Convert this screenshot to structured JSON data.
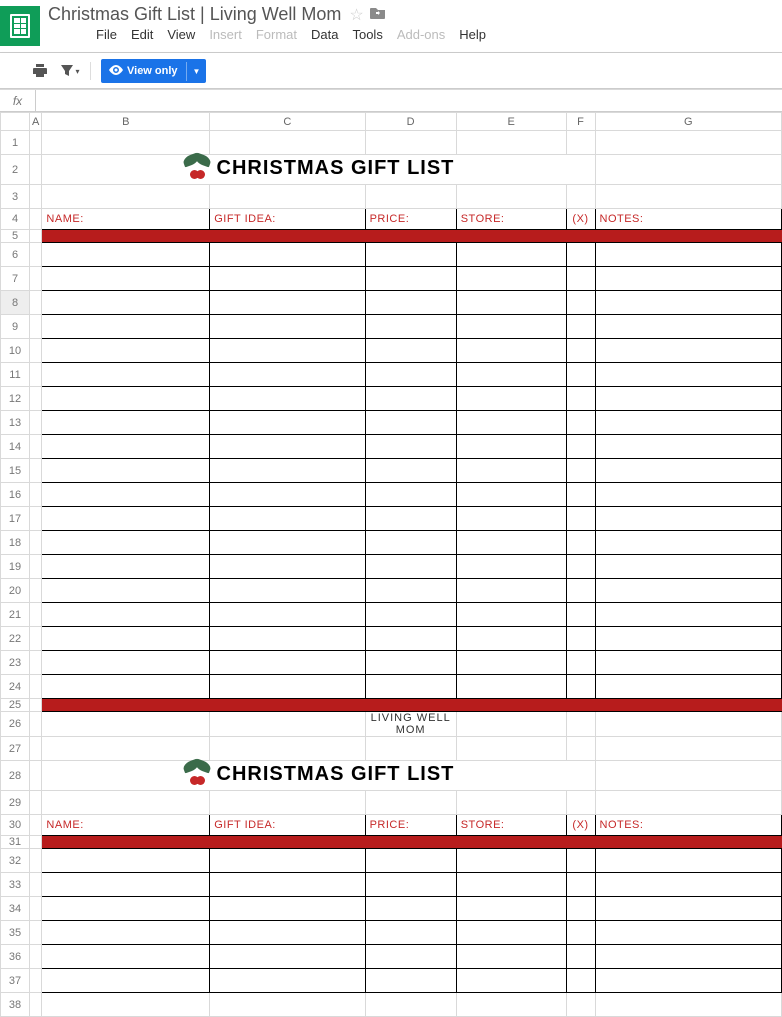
{
  "doc_title": "Christmas Gift List | Living Well Mom",
  "menu": {
    "file": "File",
    "edit": "Edit",
    "view": "View",
    "insert": "Insert",
    "format": "Format",
    "data": "Data",
    "tools": "Tools",
    "addons": "Add-ons",
    "help": "Help"
  },
  "toolbar": {
    "view_only": "View only"
  },
  "columns": [
    "A",
    "B",
    "C",
    "D",
    "E",
    "F",
    "G"
  ],
  "sheet": {
    "title": "CHRISTMAS GIFT LIST",
    "headers": {
      "name": "NAME:",
      "gift": "GIFT IDEA:",
      "price": "PRICE:",
      "store": "STORE:",
      "check": "(X)",
      "notes": "NOTES:"
    },
    "footer": "LIVING WELL MOM"
  },
  "rows_block1": [
    6,
    7,
    8,
    9,
    10,
    11,
    12,
    13,
    14,
    15,
    16,
    17,
    18,
    19,
    20,
    21,
    22,
    23,
    24
  ],
  "rows_block2": [
    32,
    33,
    34,
    35,
    36,
    37
  ],
  "selected_row": 8
}
